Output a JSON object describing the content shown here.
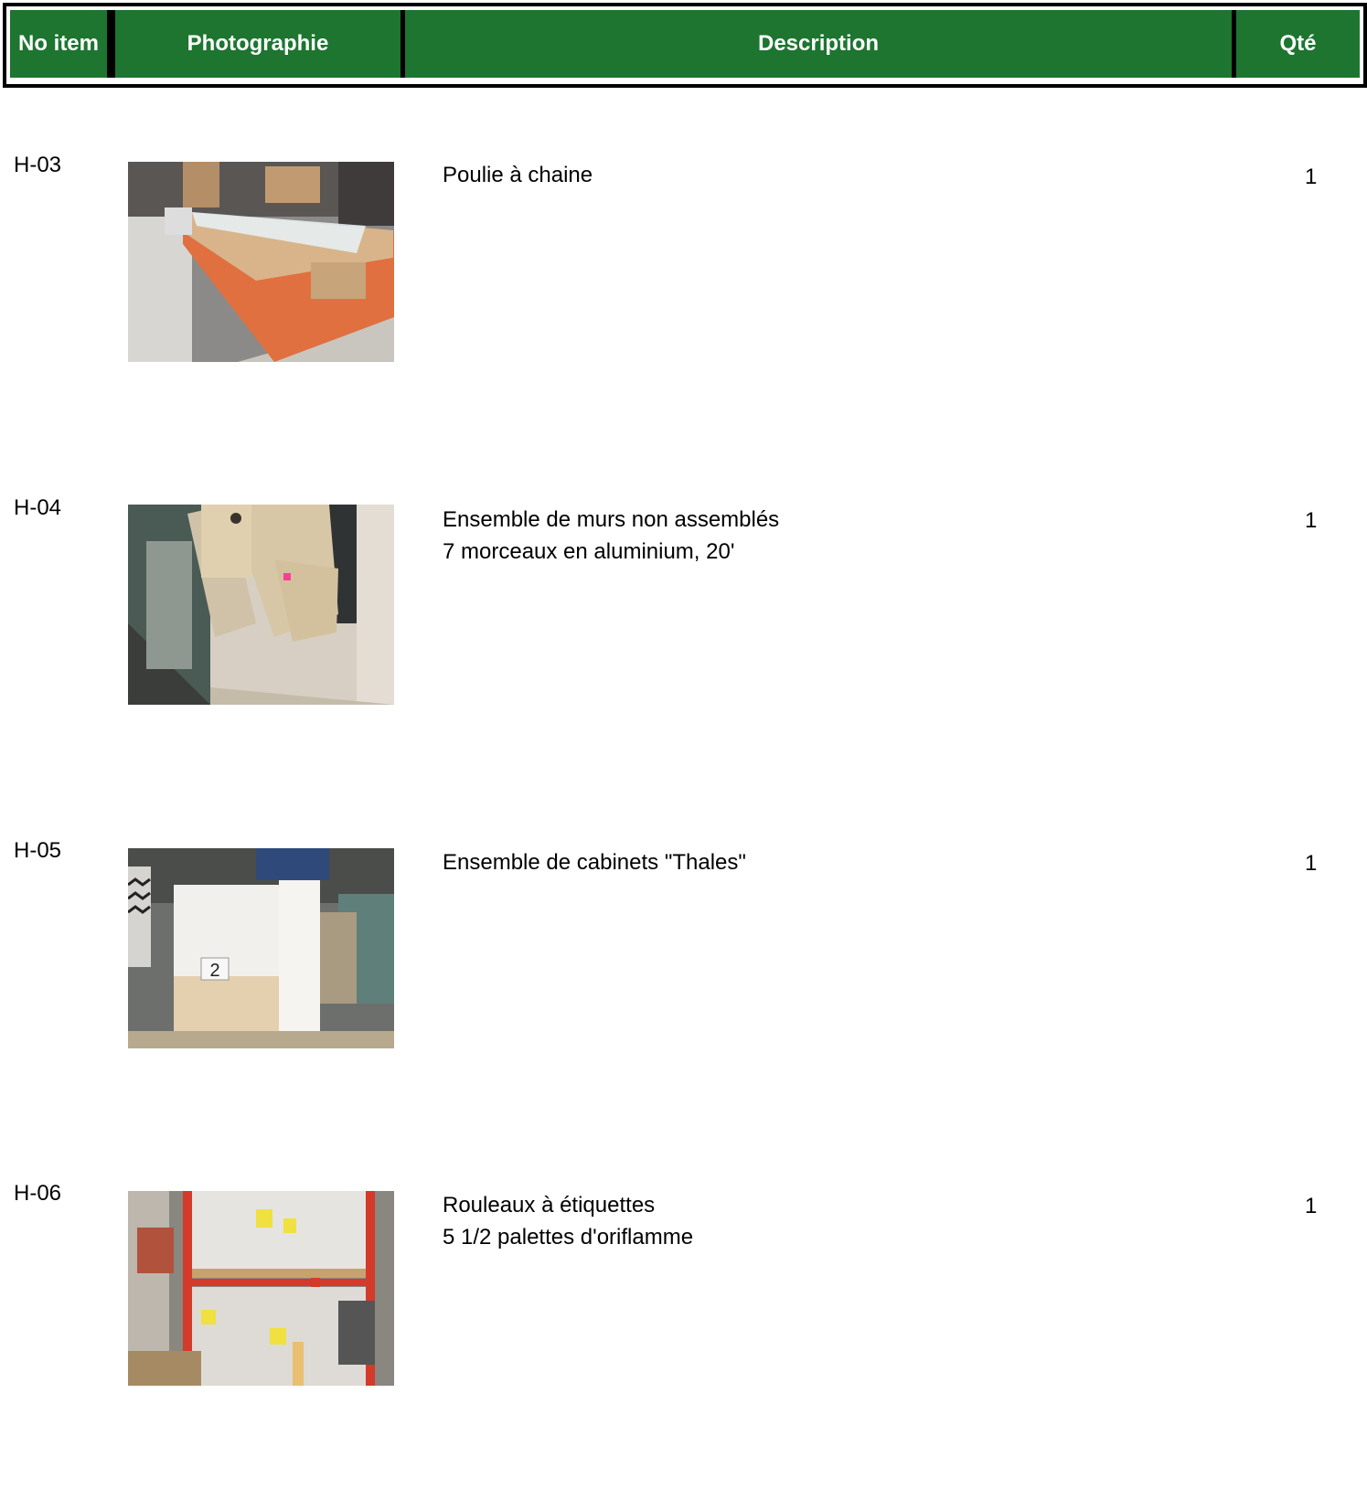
{
  "header": {
    "col_no": "No item",
    "col_photo": "Photographie",
    "col_desc": "Description",
    "col_qty": "Qté",
    "bg_color": "#1d7530"
  },
  "items": [
    {
      "no": "H-03",
      "desc1": "Poulie à chaine",
      "desc2": "",
      "qty": "1"
    },
    {
      "no": "H-04",
      "desc1": "Ensemble de murs non assemblés",
      "desc2": "7 morceaux en aluminium, 20'",
      "qty": "1"
    },
    {
      "no": "H-05",
      "desc1": "Ensemble de cabinets \"Thales\"",
      "desc2": "",
      "qty": "1",
      "photo_label": "2"
    },
    {
      "no": "H-06",
      "desc1": "Rouleaux à étiquettes",
      "desc2": "5 1/2 palettes d'oriflamme",
      "qty": "1"
    }
  ]
}
